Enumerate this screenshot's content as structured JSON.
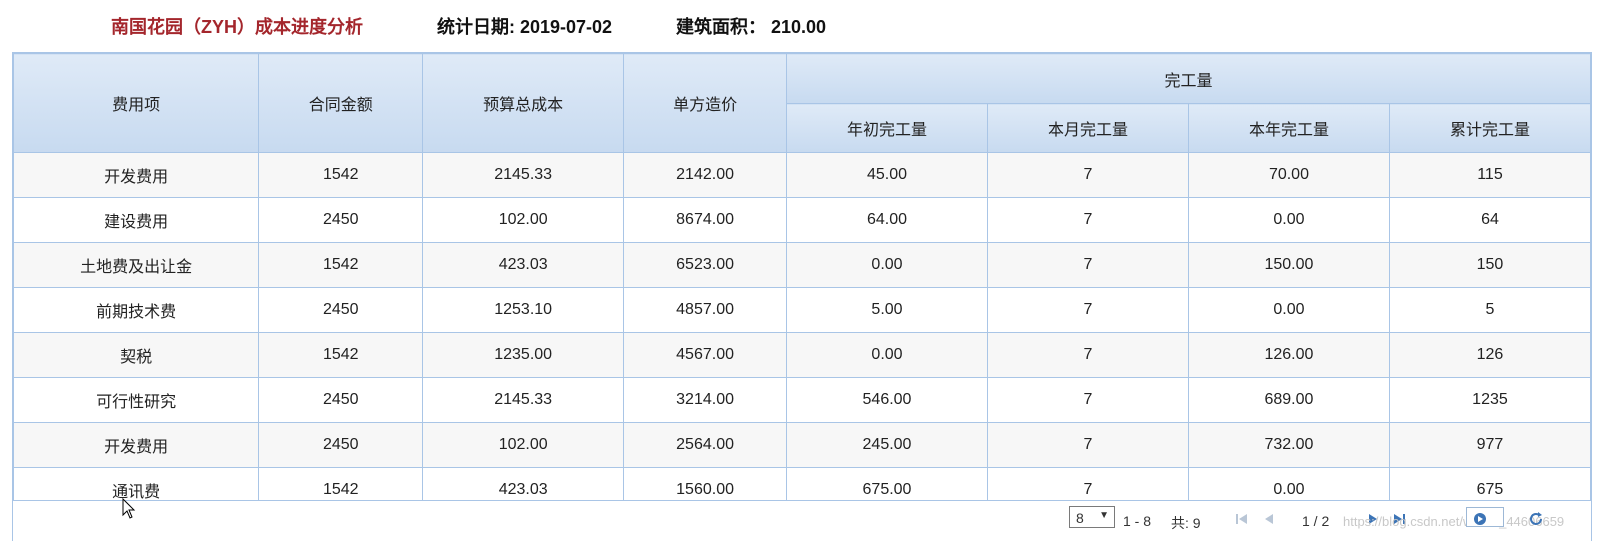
{
  "header": {
    "title": "南国花园（ZYH）成本进度分析",
    "stat_date": "统计日期: 2019-07-02",
    "area": "建筑面积： 210.00"
  },
  "table": {
    "columns": {
      "item": "费用项",
      "contract": "合同金额",
      "budget": "预算总成本",
      "unit_price": "单方造价",
      "group": "完工量",
      "year_start": "年初完工量",
      "month": "本月完工量",
      "year": "本年完工量",
      "total": "累计完工量"
    },
    "rows": [
      [
        "开发费用",
        "1542",
        "2145.33",
        "2142.00",
        "45.00",
        "7",
        "70.00",
        "115"
      ],
      [
        "建设费用",
        "2450",
        "102.00",
        "8674.00",
        "64.00",
        "7",
        "0.00",
        "64"
      ],
      [
        "土地费及出让金",
        "1542",
        "423.03",
        "6523.00",
        "0.00",
        "7",
        "150.00",
        "150"
      ],
      [
        "前期技术费",
        "2450",
        "1253.10",
        "4857.00",
        "5.00",
        "7",
        "0.00",
        "5"
      ],
      [
        "契税",
        "1542",
        "1235.00",
        "4567.00",
        "0.00",
        "7",
        "126.00",
        "126"
      ],
      [
        "可行性研究",
        "2450",
        "2145.33",
        "3214.00",
        "546.00",
        "7",
        "689.00",
        "1235"
      ],
      [
        "开发费用",
        "2450",
        "102.00",
        "2564.00",
        "245.00",
        "7",
        "732.00",
        "977"
      ],
      [
        "通讯费",
        "1542",
        "423.03",
        "1560.00",
        "675.00",
        "7",
        "0.00",
        "675"
      ]
    ]
  },
  "pager": {
    "page_size": "8",
    "range": "1 - 8",
    "total": "共: 9",
    "page_info": "1 / 2",
    "page_input": "",
    "watermark": "https://blog.csdn.net/weixin_44606659",
    "icons": [
      "first-page-icon",
      "prev-page-icon",
      "next-page-icon",
      "last-page-icon",
      "go-icon",
      "refresh-icon"
    ]
  },
  "colors": {
    "title": "#a4262c",
    "border": "#a9c5e6",
    "header_bg": "#c7daf0"
  }
}
